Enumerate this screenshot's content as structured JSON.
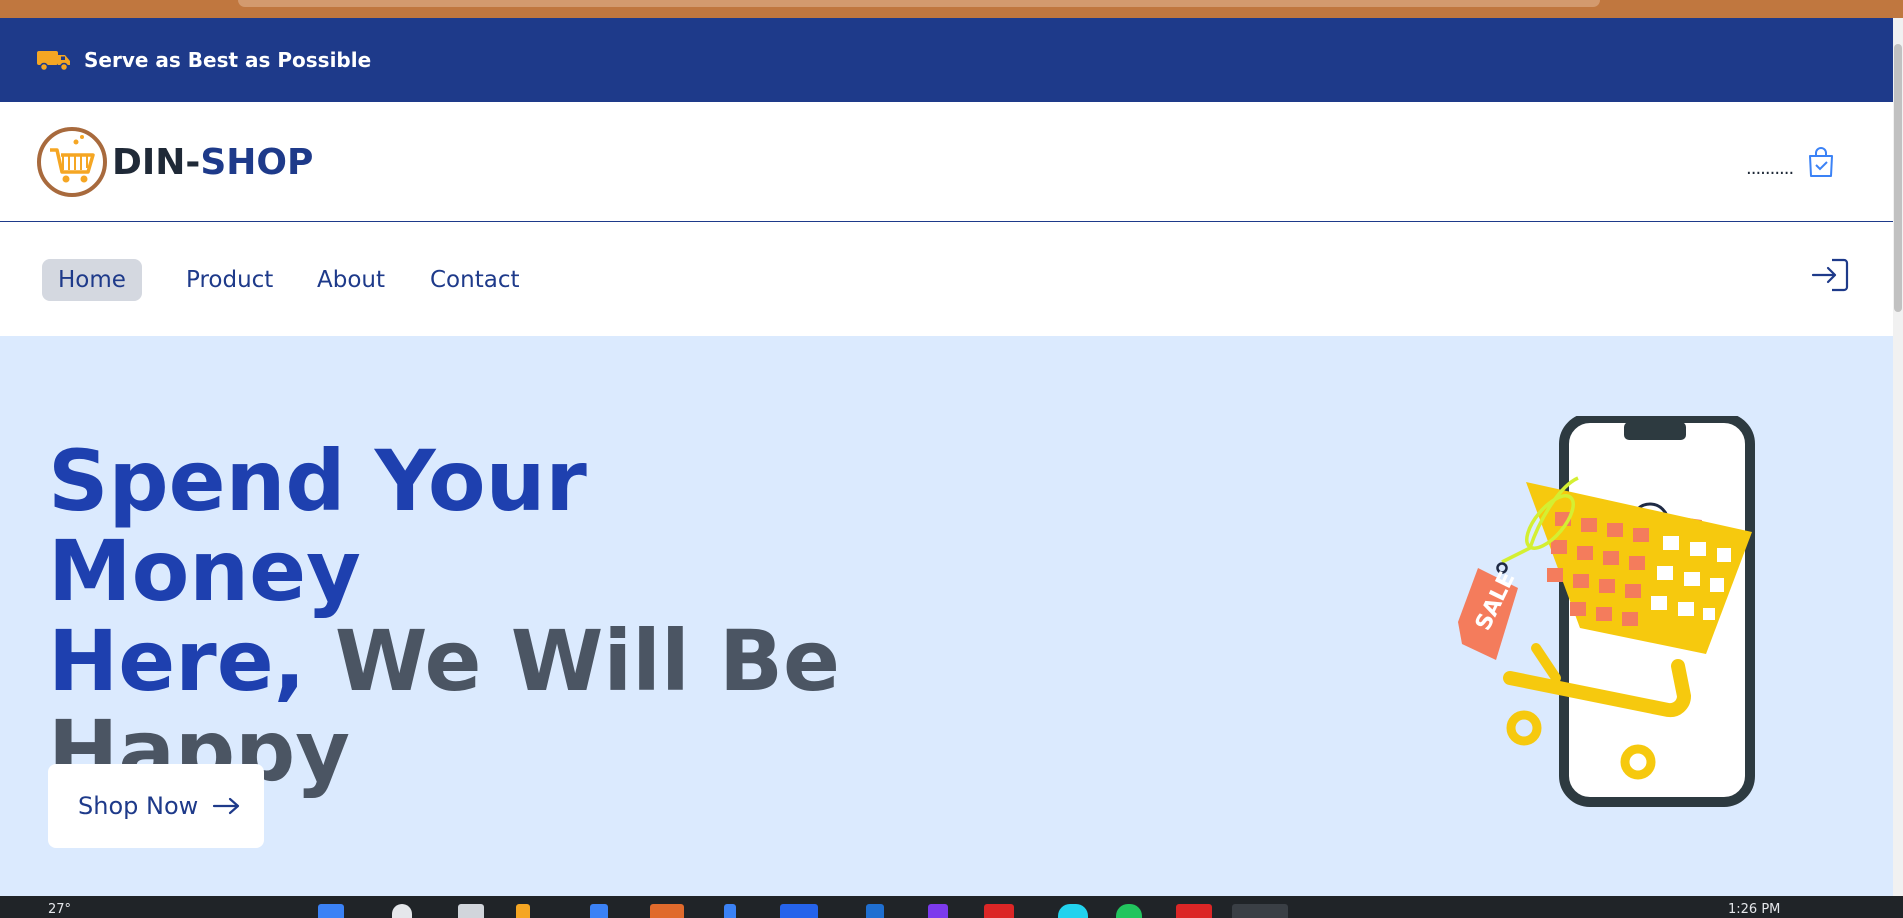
{
  "announcement": {
    "text": "Serve as Best as Possible",
    "icon": "truck-icon"
  },
  "brand": {
    "prefix": "DIN",
    "separator": "-",
    "suffix": "SHOP",
    "logo_icon": "shopping-cart-icon"
  },
  "header": {
    "cart_count": "..........",
    "cart_icon": "shopping-bag-icon"
  },
  "nav": {
    "items": [
      {
        "label": "Home",
        "active": true
      },
      {
        "label": "Product",
        "active": false
      },
      {
        "label": "About",
        "active": false
      },
      {
        "label": "Contact",
        "active": false
      }
    ],
    "login_icon": "login-icon"
  },
  "hero": {
    "headline_blue_1": "Spend Your Money",
    "headline_blue_2": "Here,",
    "headline_gray_1": " We Will Be",
    "headline_gray_2": "Happy",
    "cta_label": "Shop Now",
    "cta_icon": "arrow-right-icon",
    "illustration_text": "SALE"
  },
  "taskbar": {
    "temperature": "27°",
    "time": "1:26 PM"
  },
  "colors": {
    "primary": "#1e3a8a",
    "hero_blue": "#1e40af",
    "hero_gray": "#4b5563",
    "hero_bg": "#dbeafe",
    "accent_orange": "#f5a623",
    "cart_yellow": "#f6c90e",
    "sale_coral": "#f47c5c"
  }
}
